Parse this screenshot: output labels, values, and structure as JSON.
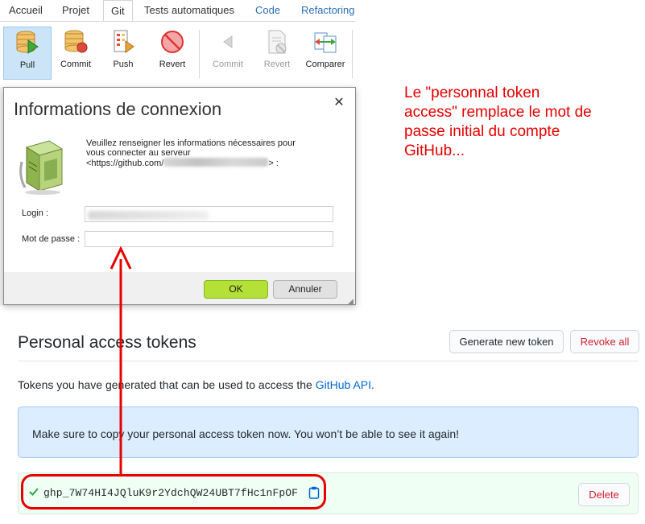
{
  "ribbon": {
    "tabs": [
      {
        "label": "Accueil"
      },
      {
        "label": "Projet"
      },
      {
        "label": "Git"
      },
      {
        "label": "Tests automatiques"
      },
      {
        "label": "Code"
      },
      {
        "label": "Refactoring"
      }
    ],
    "buttons": [
      {
        "label": "Pull",
        "icon": "pull-icon"
      },
      {
        "label": "Commit",
        "icon": "commit-icon"
      },
      {
        "label": "Push",
        "icon": "push-icon"
      },
      {
        "label": "Revert",
        "icon": "revert-icon"
      },
      {
        "label": "Commit",
        "icon": "commit-disabled-icon"
      },
      {
        "label": "Revert",
        "icon": "revert-disabled-icon"
      },
      {
        "label": "Comparer",
        "icon": "compare-icon"
      }
    ]
  },
  "dialog": {
    "title": "Informations de connexion",
    "message_line1": "Veuillez renseigner les informations nécessaires pour",
    "message_line2": "vous connecter au serveur",
    "message_prefix": "<https://github.com/",
    "message_suffix": "> :",
    "login_label": "Login :",
    "password_label": "Mot de passe :",
    "ok_label": "OK",
    "cancel_label": "Annuler"
  },
  "annotation": {
    "line1": "Le \"personnal token",
    "line2": "access\" remplace le mot de",
    "line3": "passe initial du compte",
    "line4": "GitHub...",
    "color": "#e60000"
  },
  "github": {
    "section_title": "Personal access tokens",
    "generate_button": "Generate new token",
    "revoke_all_button": "Revoke all",
    "description_prefix": "Tokens you have generated that can be used to access the ",
    "description_link": "GitHub API",
    "description_suffix": ".",
    "flash_message": "Make sure to copy your personal access token now. You won’t be able to see it again!",
    "token": "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",
    "delete_button": "Delete"
  },
  "colors": {
    "accent_blue": "#2a6fb5",
    "ok_green": "#b4e038",
    "github_link": "#0366d6",
    "danger": "#cb2431"
  }
}
